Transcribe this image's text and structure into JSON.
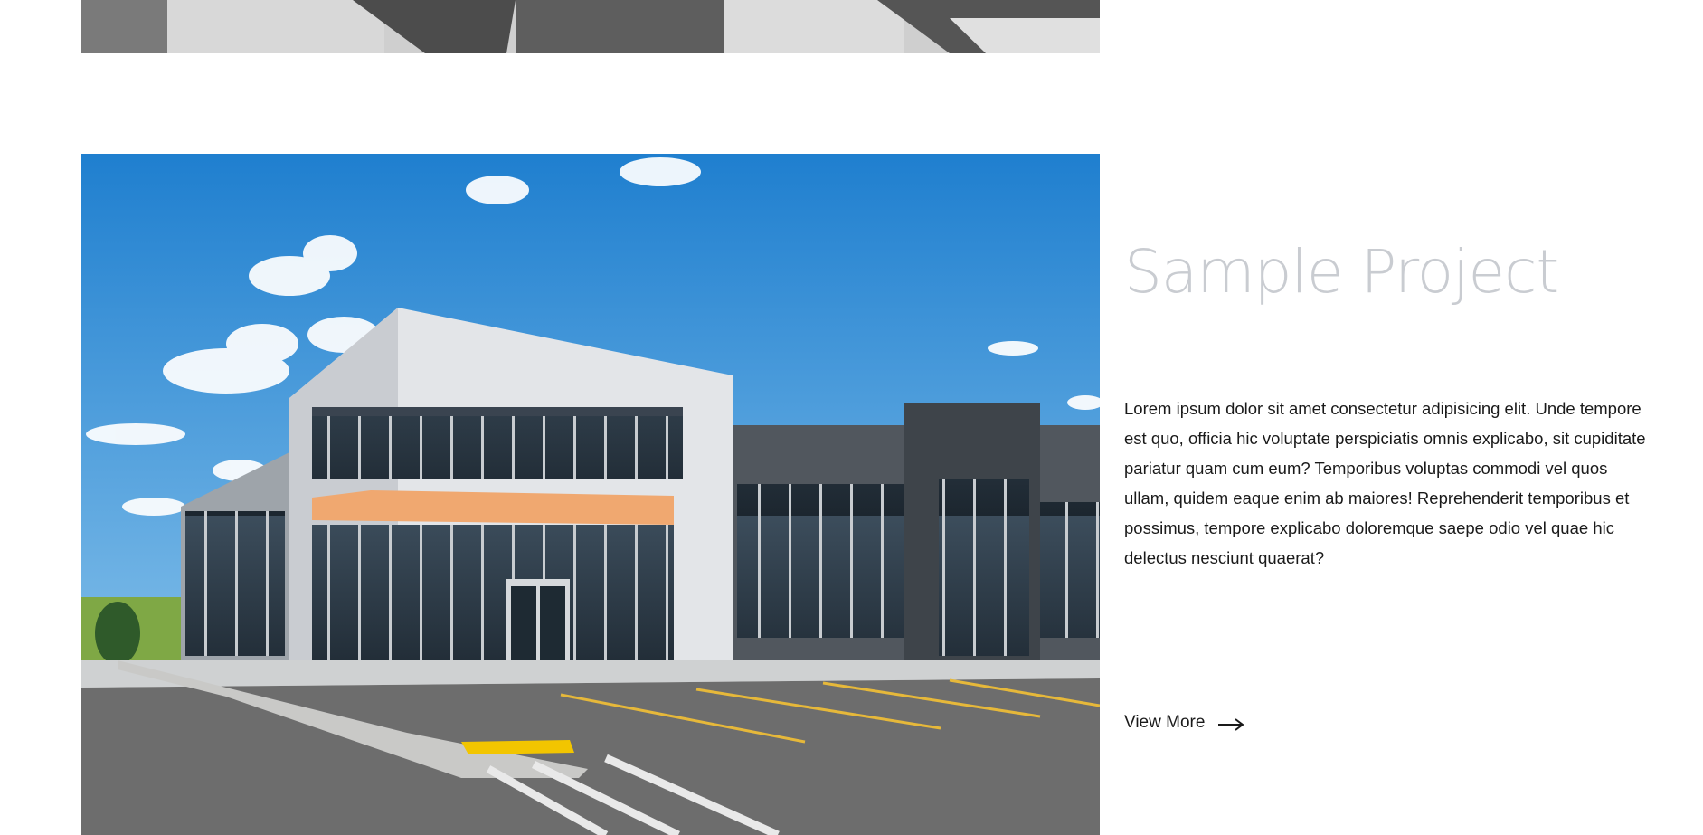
{
  "project": {
    "title": "Sample Project",
    "description": "Lorem ipsum dolor sit amet consectetur adipisicing elit. Unde tempore est quo, officia hic voluptate perspiciatis omnis explicabo, sit cupiditate pariatur quam cum eum? Temporibus voluptas commodi vel quos ullam, quidem eaque enim ab maiores! Reprehenderit temporibus et possimus, tempore explicabo doloremque saepe odio vel quae hic delectus nesciunt quaerat?",
    "link_label": "View More",
    "link_icon": "arrow-right-icon"
  },
  "colors": {
    "title": "#c9ccd1",
    "body_text": "#1a1a1a",
    "sky": "#3a8fd2",
    "facade_accent": "#f0a870"
  }
}
